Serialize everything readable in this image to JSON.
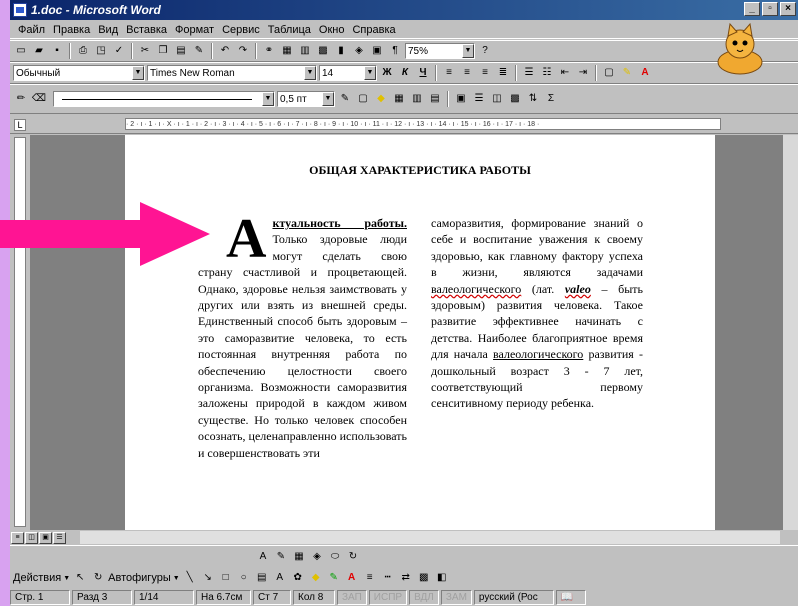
{
  "window": {
    "title": "1.doc - Microsoft Word",
    "min_label": "_",
    "restore_label": "▫",
    "close_label": "×"
  },
  "menu": [
    "Файл",
    "Правка",
    "Вид",
    "Вставка",
    "Формат",
    "Сервис",
    "Таблица",
    "Окно",
    "Справка"
  ],
  "toolbar": {
    "zoom": "75%",
    "style": "Обычный",
    "font": "Times New Roman",
    "size": "14",
    "bold": "Ж",
    "italic": "К",
    "underline": "Ч",
    "line_weight": "0,5 пт"
  },
  "ruler": {
    "ticks": "· 2 · ı · 1 · ı · X · ı · 1 · ı · 2 · ı · 3 · ı · 4 · ı · 5 · ı · 6 · ı · 7 · ı · 8 · ı · 9 · ı · 10 · ı · 11 · ı · 12 · ı · 13 · ı · 14 · ı · 15 · ı · 16 · ı · 17 · ı · 18 ·"
  },
  "document": {
    "title": "ОБЩАЯ ХАРАКТЕРИСТИКА РАБОТЫ",
    "dropcap": "А",
    "col1_lead": "ктуальность работы.",
    "col1_text": " Только здоровые люди могут сделать свою страну счастливой и процветающей. Однако, здоровье нельзя заимствовать у других или взять из внешней среды. Единственный способ быть здоровым – это саморазвитие человека, то есть постоянная внутренняя работа по обеспечению целостности своего организма. Возможности саморазвития заложены природой в каждом живом существе. Но только человек способен осознать, целенаправленно использовать и совершенствовать эти",
    "col2_a": "саморазвития, формирование знаний о себе и воспитание уважения к своему здоровью, как главному фактору успеха в жизни, являются задачами ",
    "col2_valeo": "валеологического",
    "col2_b": " (лат. ",
    "col2_valeo_word": "valeo",
    "col2_c": " – быть здоровым) развития человека. Такое развитие эффективнее начинать с детства. Наиболее благоприятное время для начала ",
    "col2_valeo2": "валеологического",
    "col2_d": " развития - дошкольный возраст 3 - 7 лет, соответствующий первому сенситивному периоду ребенка."
  },
  "drawing": {
    "actions": "Действия",
    "autoshapes": "Автофигуры"
  },
  "status": {
    "page": "Стр. 1",
    "section": "Разд 3",
    "pages": "1/14",
    "at": "На 6.7см",
    "line": "Ст 7",
    "col": "Кол 8",
    "rec": "ЗАП",
    "trk": "ИСПР",
    "ext": "ВДЛ",
    "ovr": "ЗАМ",
    "lang": "русский (Рос"
  },
  "colors": {
    "arrow": "#ff1493",
    "title_grad_start": "#0a246a",
    "title_grad_end": "#3a6ea5",
    "background": "#d8a2f0"
  }
}
